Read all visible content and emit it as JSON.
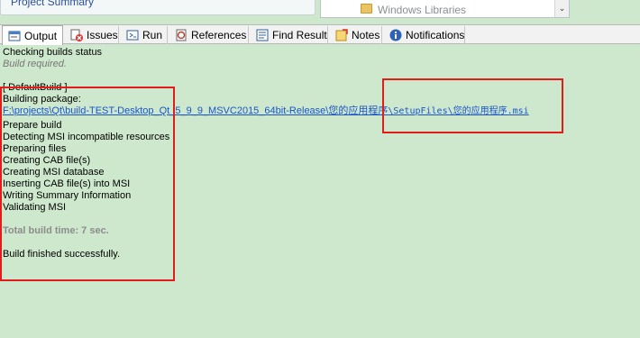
{
  "top": {
    "project_summary": "Project Summary",
    "libraries_value": "Windows Libraries",
    "dropdown_glyph": "⌄"
  },
  "tabs": [
    {
      "label": "Output",
      "icon": "output-icon"
    },
    {
      "label": "Issues",
      "icon": "issues-icon"
    },
    {
      "label": "Run",
      "icon": "run-icon"
    },
    {
      "label": "References",
      "icon": "references-icon"
    },
    {
      "label": "Find Result",
      "icon": "find-result-icon"
    },
    {
      "label": "Notes",
      "icon": "notes-icon"
    },
    {
      "label": "Notifications",
      "icon": "notifications-icon"
    }
  ],
  "output": {
    "status_title": "Checking builds status",
    "status_sub": "Build required.",
    "default_build": "[ DefaultBuild ]",
    "building_package": "Building package:",
    "path_link_part1": "F:\\projects\\Qt\\build-TEST-Desktop_Qt_5_9_9_MSVC2015_64bit-Release\\您的应用程序",
    "path_link_part2": "\\SetupFiles\\您的应用程序.msi",
    "steps": [
      "Prepare build",
      "Detecting MSI incompatible resources",
      "Preparing files",
      "Creating CAB file(s)",
      "Creating MSI database",
      "Inserting CAB file(s) into MSI",
      "Writing Summary Information",
      "Validating MSI"
    ],
    "total_time": "Total build time: 7 sec.",
    "finished": "Build finished successfully."
  },
  "colors": {
    "background": "#cde8cc",
    "link": "#1b55c9",
    "highlight_box": "#e21b1b"
  }
}
